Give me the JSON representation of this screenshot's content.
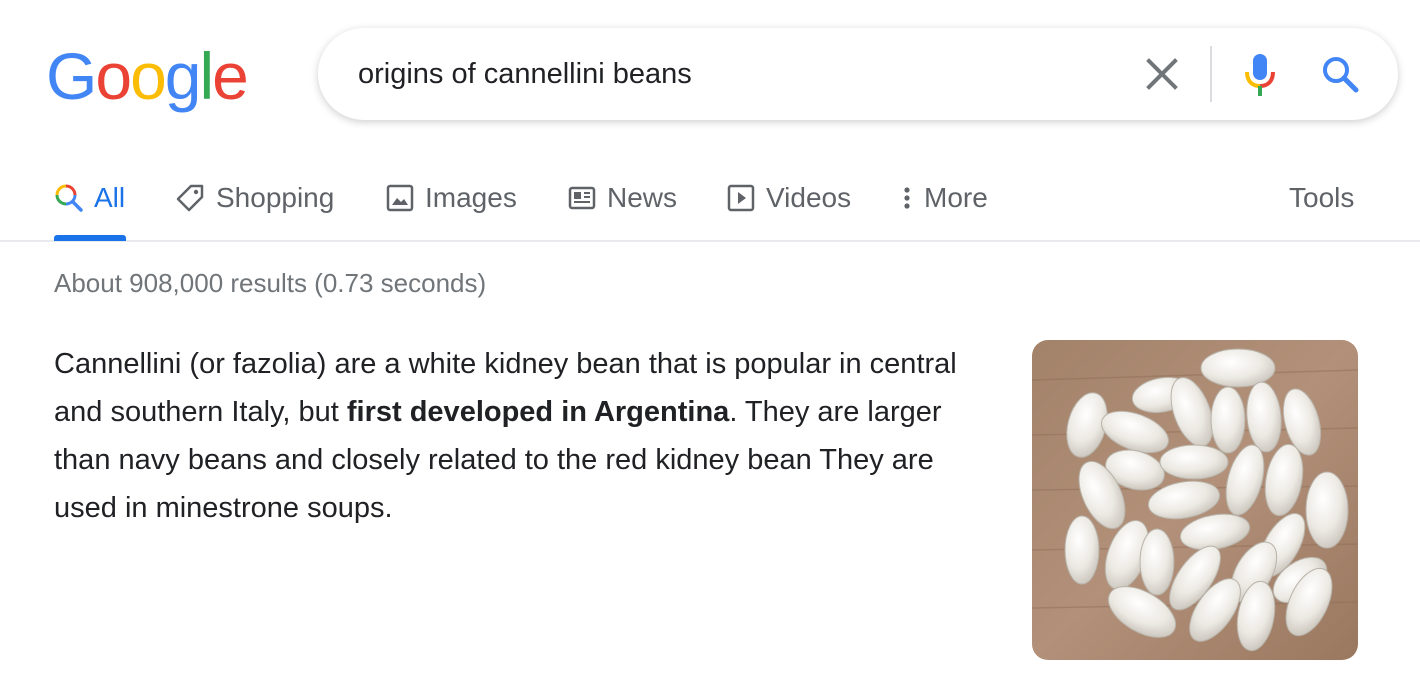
{
  "logo": {
    "letters": [
      "G",
      "o",
      "o",
      "g",
      "l",
      "e"
    ]
  },
  "search": {
    "query": "origins of cannellini beans"
  },
  "tabs": [
    {
      "label": "All",
      "icon": "search-icon",
      "active": true
    },
    {
      "label": "Shopping",
      "icon": "tag-icon"
    },
    {
      "label": "Images",
      "icon": "image-icon"
    },
    {
      "label": "News",
      "icon": "newspaper-icon"
    },
    {
      "label": "Videos",
      "icon": "play-icon"
    },
    {
      "label": "More",
      "icon": "vertical-dots-icon"
    }
  ],
  "tools_label": "Tools",
  "result_stats": "About 908,000 results (0.73 seconds)",
  "snippet": {
    "before": "Cannellini (or fazolia) are a white kidney bean that is popular in central and southern Italy, but ",
    "bold": "first developed in Argentina",
    "after": ". They are larger than navy beans and closely related to the red kidney bean They are used in minestrone soups."
  },
  "colors": {
    "google_blue": "#4285F4",
    "google_red": "#EA4335",
    "google_yellow": "#FBBC05",
    "google_green": "#34A853",
    "active_tab": "#1a73e8",
    "muted_text": "#70757a"
  }
}
